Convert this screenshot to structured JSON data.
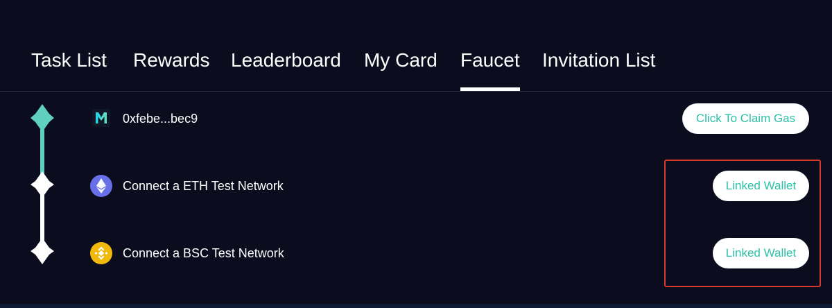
{
  "tabs": [
    {
      "label": "Task List",
      "active": false
    },
    {
      "label": "Rewards",
      "active": false
    },
    {
      "label": "Leaderboard",
      "active": false
    },
    {
      "label": "My Card",
      "active": false
    },
    {
      "label": "Faucet",
      "active": true
    },
    {
      "label": "Invitation List",
      "active": false
    }
  ],
  "rows": [
    {
      "icon": "metis-logo-icon",
      "label": "0xfebe...bec9",
      "button": "Click To Claim Gas"
    },
    {
      "icon": "eth-icon",
      "label": "Connect a ETH Test Network",
      "button": "Linked Wallet"
    },
    {
      "icon": "bnb-icon",
      "label": "Connect a BSC Test Network",
      "button": "Linked Wallet"
    }
  ],
  "colors": {
    "background": "#0c0c1f",
    "accent": "#2cc0a7",
    "timeline_done": "#5fcfbf",
    "highlight": "#d9382c",
    "eth": "#6770e6",
    "bnb": "#f0b90b"
  }
}
